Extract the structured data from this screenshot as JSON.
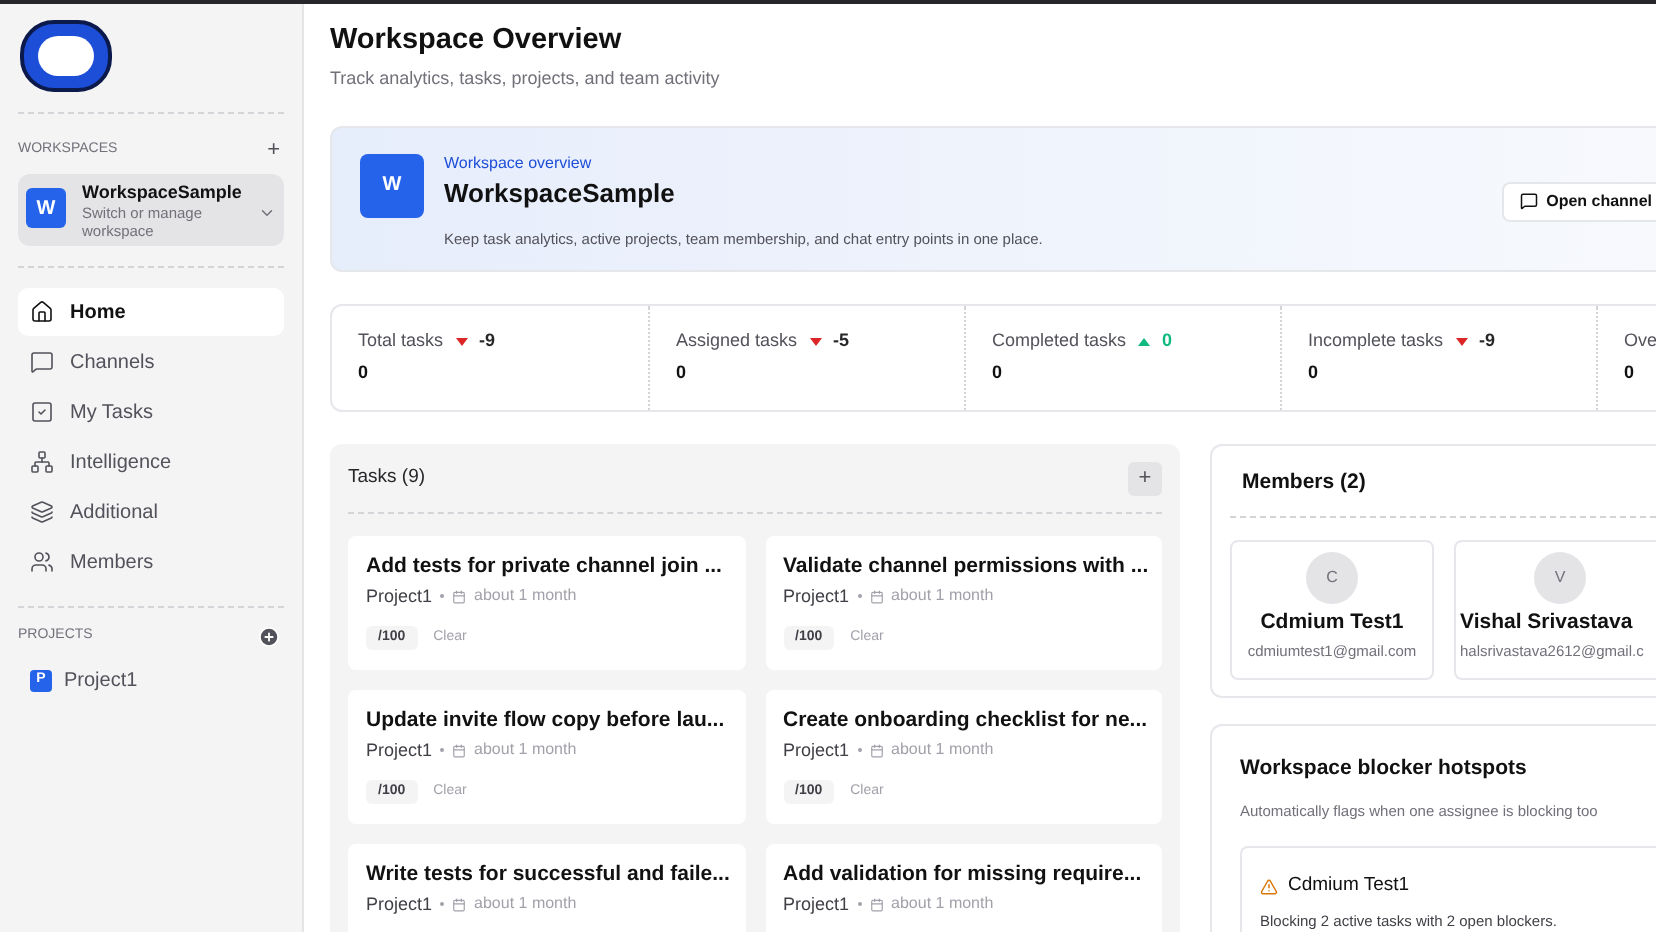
{
  "sidebar": {
    "workspaces_label": "WORKSPACES",
    "add_workspace": "+",
    "workspace": {
      "initial": "W",
      "name": "WorkspaceSample",
      "hint": "Switch or manage workspace"
    },
    "nav": [
      {
        "label": "Home",
        "selected": true
      },
      {
        "label": "Channels",
        "selected": false
      },
      {
        "label": "My Tasks",
        "selected": false
      },
      {
        "label": "Intelligence",
        "selected": false
      },
      {
        "label": "Additional",
        "selected": false
      },
      {
        "label": "Members",
        "selected": false
      }
    ],
    "projects_label": "PROJECTS",
    "projects": [
      {
        "initial": "P",
        "name": "Project1"
      }
    ]
  },
  "header": {
    "title": "Workspace Overview",
    "subtitle": "Track analytics, tasks, projects, and team activity"
  },
  "banner": {
    "eyebrow": "Workspace overview",
    "initial": "W",
    "name": "WorkspaceSample",
    "description": "Keep task analytics, active projects, team membership, and chat entry points in one place.",
    "button": "Open channel"
  },
  "stats": [
    {
      "label": "Total tasks",
      "rising": false,
      "delta": "-9",
      "value": "0"
    },
    {
      "label": "Assigned tasks",
      "rising": false,
      "delta": "-5",
      "value": "0"
    },
    {
      "label": "Completed tasks",
      "rising": true,
      "delta": "0",
      "value": "0"
    },
    {
      "label": "Incomplete tasks",
      "rising": false,
      "delta": "-9",
      "value": "0"
    },
    {
      "label": "Ove",
      "value": "0"
    }
  ],
  "tasks": {
    "title": "Tasks (9)",
    "add": "+",
    "items": [
      {
        "title": "Add tests for private channel join ...",
        "project": "Project1",
        "due": "about 1 month",
        "score": "/100",
        "clear": "Clear"
      },
      {
        "title": "Validate channel permissions with ...",
        "project": "Project1",
        "due": "about 1 month",
        "score": "/100",
        "clear": "Clear"
      },
      {
        "title": "Update invite flow copy before lau...",
        "project": "Project1",
        "due": "about 1 month",
        "score": "/100",
        "clear": "Clear"
      },
      {
        "title": "Create onboarding checklist for ne...",
        "project": "Project1",
        "due": "about 1 month",
        "score": "/100",
        "clear": "Clear"
      },
      {
        "title": "Write tests for successful and faile...",
        "project": "Project1",
        "due": "about 1 month"
      },
      {
        "title": "Add validation for missing require...",
        "project": "Project1",
        "due": "about 1 month"
      }
    ]
  },
  "members": {
    "title": "Members (2)",
    "items": [
      {
        "initial": "C",
        "name": "Cdmium Test1",
        "email": "cdmiumtest1@gmail.com"
      },
      {
        "initial": "V",
        "name": "Vishal Srivastava",
        "email": "halsrivastava2612@gmail.c"
      }
    ]
  },
  "blockers": {
    "title": "Workspace blocker hotspots",
    "description": "Automatically flags when one assignee is blocking too",
    "items": [
      {
        "name": "Cdmium Test1",
        "detail": "Blocking 2 active tasks with 2 open blockers."
      }
    ]
  }
}
